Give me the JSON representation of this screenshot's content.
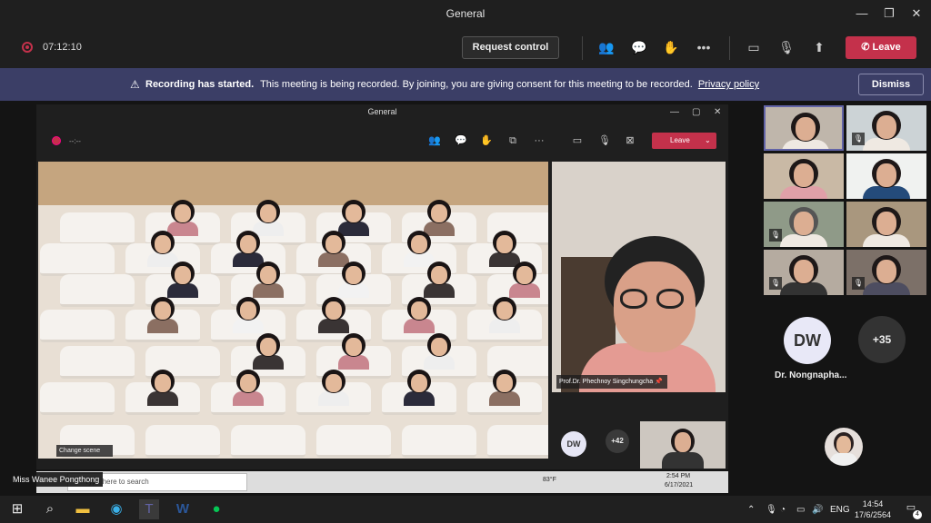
{
  "window": {
    "title": "General"
  },
  "toolbar": {
    "timer": "07:12:10",
    "request_control": "Request control",
    "leave": "Leave"
  },
  "banner": {
    "bold": "Recording has started.",
    "text": "This meeting is being recorded. By joining, you are giving consent for this meeting to be recorded.",
    "link": "Privacy policy",
    "dismiss": "Dismiss"
  },
  "shared": {
    "title": "General",
    "timer": "--:--",
    "leave": "Leave",
    "change_scene": "Change scene",
    "speaker_name": "Prof.Dr. Phechnoy Singchungcha",
    "dw_initials": "DW",
    "more_count": "+42",
    "search_placeholder": "Type here to search",
    "temp": "83°F",
    "time": "2:54 PM",
    "date": "6/17/2021"
  },
  "presenter_name": "Miss Wanee Pongthong",
  "roster": {
    "dw_initials": "DW",
    "dw_name": "Dr. Nongnapha...",
    "more_count": "+35"
  },
  "taskbar": {
    "lang": "ENG",
    "time": "14:54",
    "date": "17/6/2564",
    "notifications": "4"
  },
  "colors": {
    "accent": "#6264a7",
    "leave": "#c4314b",
    "banner": "#3b3e66"
  }
}
